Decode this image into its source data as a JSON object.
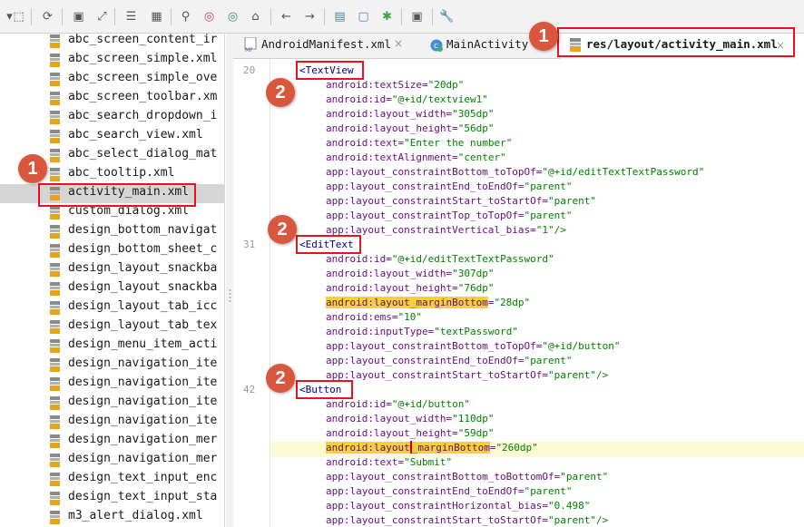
{
  "toolbar": {
    "icons": [
      "expand-icon",
      "add-module-icon",
      "sync-icon",
      "save-icon",
      "navigate-icon",
      "structure-icon",
      "project-structure-icon",
      "search-icon",
      "find-usages-icon",
      "find-in-path-icon",
      "home-icon",
      "back-icon",
      "forward-icon",
      "avd-manager-icon",
      "device-frame-icon",
      "debug-bug-icon",
      "terminal-icon",
      "settings-wrench-icon"
    ]
  },
  "tree": {
    "files": [
      "abc_screen_content_ir",
      "abc_screen_simple.xml",
      "abc_screen_simple_ove",
      "abc_screen_toolbar.xm",
      "abc_search_dropdown_i",
      "abc_search_view.xml",
      "abc_select_dialog_mat",
      "abc_tooltip.xml",
      "activity_main.xml",
      "custom_dialog.xml",
      "design_bottom_navigat",
      "design_bottom_sheet_c",
      "design_layout_snackba",
      "design_layout_snackba",
      "design_layout_tab_icc",
      "design_layout_tab_tex",
      "design_menu_item_acti",
      "design_navigation_ite",
      "design_navigation_ite",
      "design_navigation_ite",
      "design_navigation_ite",
      "design_navigation_mer",
      "design_navigation_mer",
      "design_text_input_enc",
      "design_text_input_sta",
      "m3_alert_dialog.xml"
    ],
    "selected_index": 8
  },
  "tabs": [
    {
      "label": "AndroidManifest.xml",
      "icon": "manifest-icon",
      "icon_text": "MF",
      "close": "×"
    },
    {
      "label": "MainActivity",
      "icon": "class-c-icon",
      "icon_text": "c",
      "close": ""
    },
    {
      "label": "res/layout/activity_main.xml",
      "icon": "layout-xml-icon",
      "icon_text": "",
      "close": "×"
    }
  ],
  "editor": {
    "line_numbers": [
      "20",
      "31",
      "42"
    ],
    "lines": [
      {
        "type": "tag",
        "text": "<TextView"
      },
      {
        "type": "attr",
        "name": "android:textSize",
        "value": "\"20dp\""
      },
      {
        "type": "attr",
        "name": "android:id",
        "value": "\"@+id/textview1\""
      },
      {
        "type": "attr",
        "name": "android:layout_width",
        "value": "\"305dp\""
      },
      {
        "type": "attr",
        "name": "android:layout_height",
        "value": "\"56dp\""
      },
      {
        "type": "attr",
        "name": "android:text",
        "value": "\"Enter the number\""
      },
      {
        "type": "attr",
        "name": "android:textAlignment",
        "value": "\"center\""
      },
      {
        "type": "attr",
        "name": "app:layout_constraintBottom_toTopOf",
        "value": "\"@+id/editTextTextPassword\""
      },
      {
        "type": "attr",
        "name": "app:layout_constraintEnd_toEndOf",
        "value": "\"parent\""
      },
      {
        "type": "attr",
        "name": "app:layout_constraintStart_toStartOf",
        "value": "\"parent\""
      },
      {
        "type": "attr",
        "name": "app:layout_constraintTop_toTopOf",
        "value": "\"parent\""
      },
      {
        "type": "attr",
        "name": "app:layout_constraintVertical_bias",
        "value": "\"1\"/>"
      },
      {
        "type": "tag",
        "text": "<EditText"
      },
      {
        "type": "attr",
        "name": "android:id",
        "value": "\"@+id/editTextTextPassword\""
      },
      {
        "type": "attr",
        "name": "android:layout_width",
        "value": "\"307dp\""
      },
      {
        "type": "attr",
        "name": "android:layout_height",
        "value": "\"76dp\""
      },
      {
        "type": "attr",
        "name": "android:layout_marginBottom",
        "value": "\"28dp\"",
        "highlight": true
      },
      {
        "type": "attr",
        "name": "android:ems",
        "value": "\"10\""
      },
      {
        "type": "attr",
        "name": "android:inputType",
        "value": "\"textPassword\""
      },
      {
        "type": "attr",
        "name": "app:layout_constraintBottom_toTopOf",
        "value": "\"@+id/button\""
      },
      {
        "type": "attr",
        "name": "app:layout_constraintEnd_toEndOf",
        "value": "\"parent\""
      },
      {
        "type": "attr",
        "name": "app:layout_constraintStart_toStartOf",
        "value": "\"parent\"/>"
      },
      {
        "type": "tag",
        "text": "<Button"
      },
      {
        "type": "attr",
        "name": "android:id",
        "value": "\"@+id/button\""
      },
      {
        "type": "attr",
        "name": "android:layout_width",
        "value": "\"110dp\""
      },
      {
        "type": "attr",
        "name": "android:layout_height",
        "value": "\"59dp\""
      },
      {
        "type": "attr",
        "name": "android:layout_marginBottom",
        "value": "\"260dp\"",
        "highlight": true,
        "caret": true
      },
      {
        "type": "attr",
        "name": "android:text",
        "value": "\"Submit\""
      },
      {
        "type": "attr",
        "name": "app:layout_constraintBottom_toBottomOf",
        "value": "\"parent\""
      },
      {
        "type": "attr",
        "name": "app:layout_constraintEnd_toEndOf",
        "value": "\"parent\""
      },
      {
        "type": "attr",
        "name": "app:layout_constraintHorizontal_bias",
        "value": "\"0.498\""
      },
      {
        "type": "attr",
        "name": "app:layout_constraintStart_toStartOf",
        "value": "\"parent\"/>"
      }
    ]
  },
  "annotations": {
    "badge_1": "1",
    "badge_2": "2"
  },
  "colors": {
    "annotation_red": "#e8141d",
    "badge_orange": "#d9573c",
    "highlight_yellow": "#f4d03f",
    "current_line": "#fcf9d4"
  }
}
